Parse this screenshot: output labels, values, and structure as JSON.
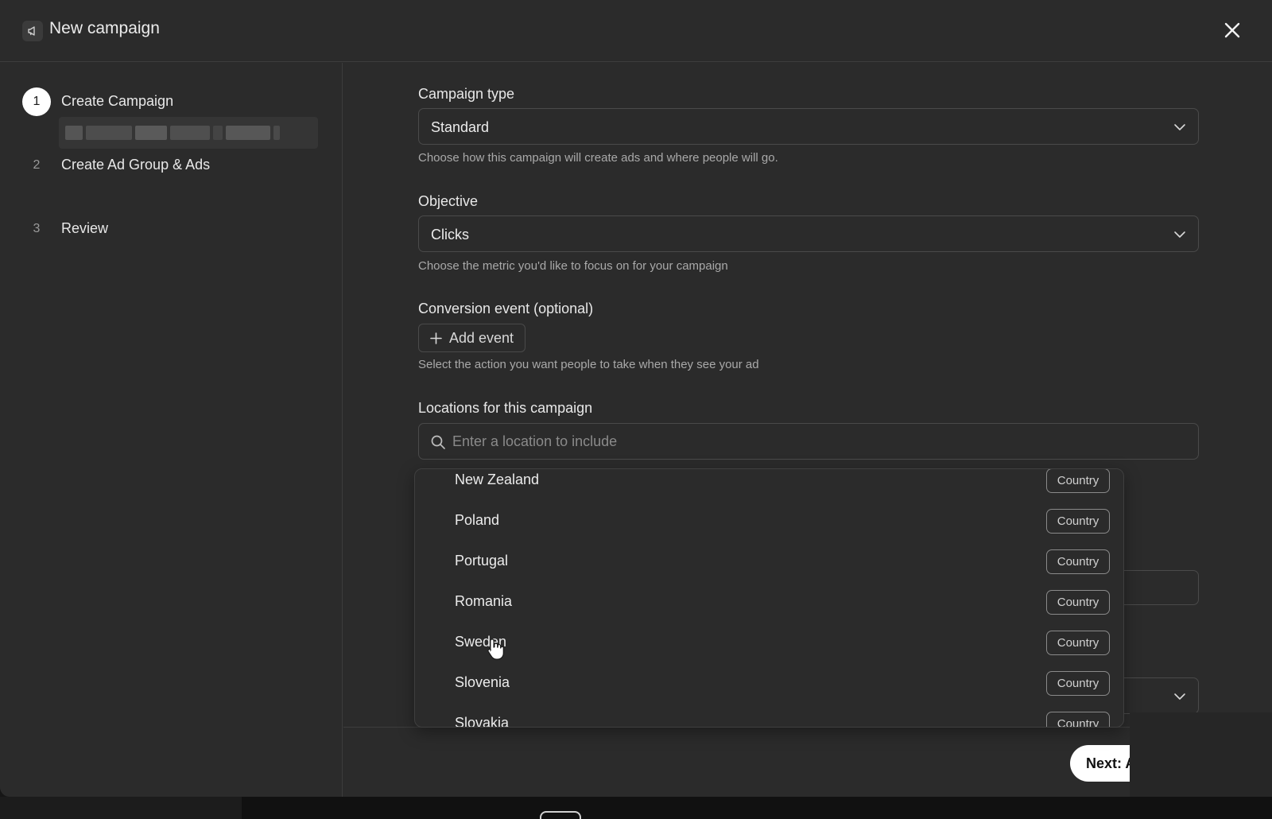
{
  "header": {
    "title": "New campaign",
    "icon": "megaphone-icon",
    "close_icon": "close-icon"
  },
  "sidebar": {
    "steps": [
      {
        "number": "1",
        "label": "Create Campaign",
        "active": true
      },
      {
        "number": "2",
        "label": "Create Ad Group & Ads",
        "active": false
      },
      {
        "number": "3",
        "label": "Review",
        "active": false
      }
    ]
  },
  "form": {
    "campaign_type": {
      "label": "Campaign type",
      "value": "Standard",
      "help": "Choose how this campaign will create ads and where people will go."
    },
    "objective": {
      "label": "Objective",
      "value": "Clicks",
      "help": "Choose the metric you'd like to focus on for your campaign"
    },
    "conversion": {
      "label": "Conversion event (optional)",
      "button_label": "Add event",
      "help": "Select the action you want people to take when they see your ad"
    },
    "locations": {
      "label": "Locations for this campaign",
      "placeholder": "Enter a location to include"
    }
  },
  "dropdown": {
    "items": [
      {
        "name": "New Zealand",
        "type": "Country"
      },
      {
        "name": "Poland",
        "type": "Country"
      },
      {
        "name": "Portugal",
        "type": "Country"
      },
      {
        "name": "Romania",
        "type": "Country"
      },
      {
        "name": "Sweden",
        "type": "Country"
      },
      {
        "name": "Slovenia",
        "type": "Country"
      },
      {
        "name": "Slovakia",
        "type": "Country"
      }
    ]
  },
  "footer": {
    "next_label": "Next: A"
  },
  "colors": {
    "background": "#2b2b2b",
    "border": "#4a4a4a",
    "primary_button": "#ffffff"
  }
}
